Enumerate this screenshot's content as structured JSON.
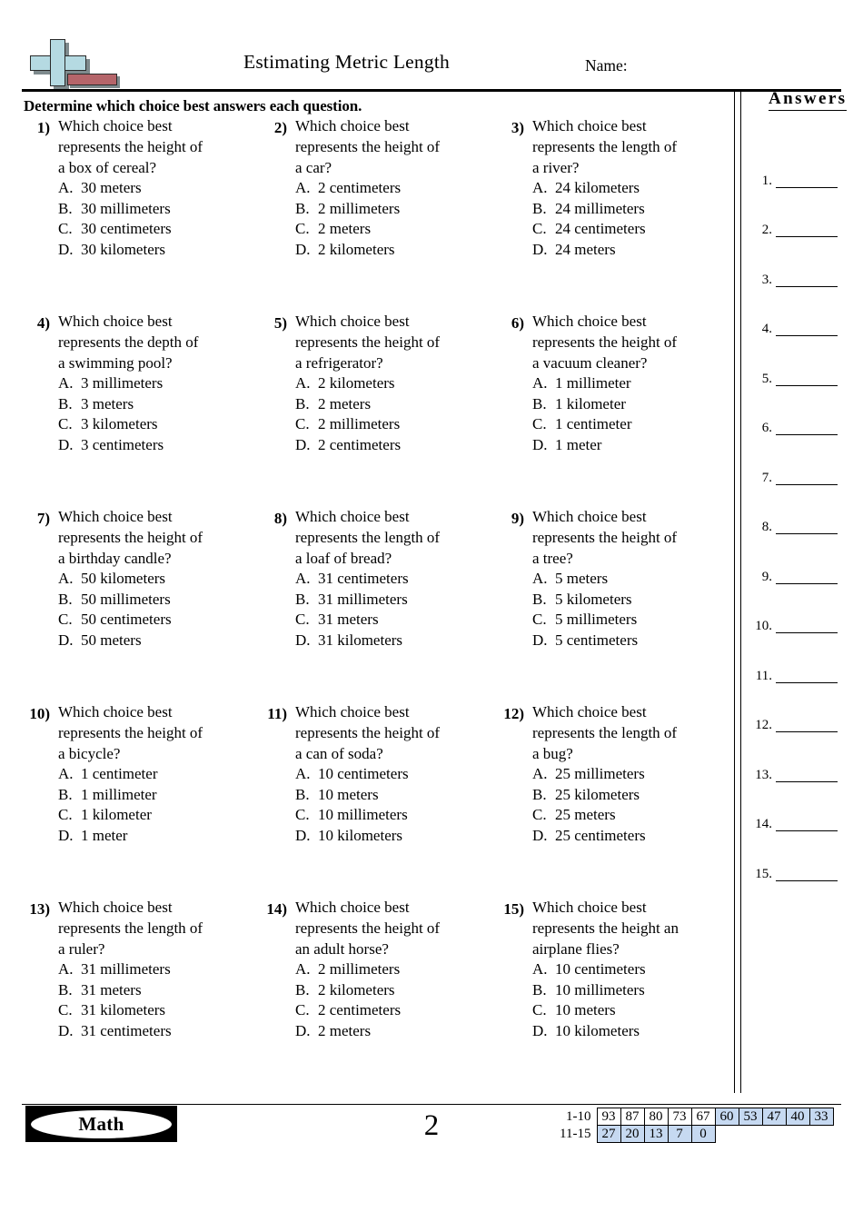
{
  "header": {
    "title": "Estimating Metric Length",
    "name_label": "Name:",
    "logo_name": "plus-minus-logo",
    "logo_colors": {
      "plus": "#b5dae2",
      "minus": "#b5656a",
      "shadow": "#7e8a8d"
    }
  },
  "instruction": "Determine which choice best answers each question.",
  "questions": [
    {
      "number": "1)",
      "text": "Which choice best\nrepresents the height of\na box of cereal?",
      "choices": [
        {
          "letter": "A.",
          "text": "30 meters"
        },
        {
          "letter": "B.",
          "text": "30 millimeters"
        },
        {
          "letter": "C.",
          "text": "30 centimeters"
        },
        {
          "letter": "D.",
          "text": "30 kilometers"
        }
      ]
    },
    {
      "number": "2)",
      "text": "Which choice best\nrepresents the height of\na car?",
      "choices": [
        {
          "letter": "A.",
          "text": "2 centimeters"
        },
        {
          "letter": "B.",
          "text": "2 millimeters"
        },
        {
          "letter": "C.",
          "text": "2 meters"
        },
        {
          "letter": "D.",
          "text": "2 kilometers"
        }
      ]
    },
    {
      "number": "3)",
      "text": "Which choice best\nrepresents the length of\na river?",
      "choices": [
        {
          "letter": "A.",
          "text": "24 kilometers"
        },
        {
          "letter": "B.",
          "text": "24 millimeters"
        },
        {
          "letter": "C.",
          "text": "24 centimeters"
        },
        {
          "letter": "D.",
          "text": "24 meters"
        }
      ]
    },
    {
      "number": "4)",
      "text": "Which choice best\nrepresents the depth of\na swimming pool?",
      "choices": [
        {
          "letter": "A.",
          "text": "3 millimeters"
        },
        {
          "letter": "B.",
          "text": "3 meters"
        },
        {
          "letter": "C.",
          "text": "3 kilometers"
        },
        {
          "letter": "D.",
          "text": "3 centimeters"
        }
      ]
    },
    {
      "number": "5)",
      "text": "Which choice best\nrepresents the height of\na refrigerator?",
      "choices": [
        {
          "letter": "A.",
          "text": "2 kilometers"
        },
        {
          "letter": "B.",
          "text": "2 meters"
        },
        {
          "letter": "C.",
          "text": "2 millimeters"
        },
        {
          "letter": "D.",
          "text": "2 centimeters"
        }
      ]
    },
    {
      "number": "6)",
      "text": "Which choice best\nrepresents the height of\na vacuum cleaner?",
      "choices": [
        {
          "letter": "A.",
          "text": "1 millimeter"
        },
        {
          "letter": "B.",
          "text": "1 kilometer"
        },
        {
          "letter": "C.",
          "text": "1 centimeter"
        },
        {
          "letter": "D.",
          "text": "1 meter"
        }
      ]
    },
    {
      "number": "7)",
      "text": "Which choice best\nrepresents the height of\na birthday candle?",
      "choices": [
        {
          "letter": "A.",
          "text": "50 kilometers"
        },
        {
          "letter": "B.",
          "text": "50 millimeters"
        },
        {
          "letter": "C.",
          "text": "50 centimeters"
        },
        {
          "letter": "D.",
          "text": "50 meters"
        }
      ]
    },
    {
      "number": "8)",
      "text": "Which choice best\nrepresents the length of\na loaf of bread?",
      "choices": [
        {
          "letter": "A.",
          "text": "31 centimeters"
        },
        {
          "letter": "B.",
          "text": "31 millimeters"
        },
        {
          "letter": "C.",
          "text": "31 meters"
        },
        {
          "letter": "D.",
          "text": "31 kilometers"
        }
      ]
    },
    {
      "number": "9)",
      "text": "Which choice best\nrepresents the height of\na tree?",
      "choices": [
        {
          "letter": "A.",
          "text": "5 meters"
        },
        {
          "letter": "B.",
          "text": "5 kilometers"
        },
        {
          "letter": "C.",
          "text": "5 millimeters"
        },
        {
          "letter": "D.",
          "text": "5 centimeters"
        }
      ]
    },
    {
      "number": "10)",
      "text": "Which choice best\nrepresents the height of\na bicycle?",
      "choices": [
        {
          "letter": "A.",
          "text": "1 centimeter"
        },
        {
          "letter": "B.",
          "text": "1 millimeter"
        },
        {
          "letter": "C.",
          "text": "1 kilometer"
        },
        {
          "letter": "D.",
          "text": "1 meter"
        }
      ]
    },
    {
      "number": "11)",
      "text": "Which choice best\nrepresents the height of\na can of soda?",
      "choices": [
        {
          "letter": "A.",
          "text": "10 centimeters"
        },
        {
          "letter": "B.",
          "text": "10 meters"
        },
        {
          "letter": "C.",
          "text": "10 millimeters"
        },
        {
          "letter": "D.",
          "text": "10 kilometers"
        }
      ]
    },
    {
      "number": "12)",
      "text": "Which choice best\nrepresents the length of\na bug?",
      "choices": [
        {
          "letter": "A.",
          "text": "25 millimeters"
        },
        {
          "letter": "B.",
          "text": "25 kilometers"
        },
        {
          "letter": "C.",
          "text": "25 meters"
        },
        {
          "letter": "D.",
          "text": "25 centimeters"
        }
      ]
    },
    {
      "number": "13)",
      "text": "Which choice best\nrepresents the length of\na ruler?",
      "choices": [
        {
          "letter": "A.",
          "text": "31 millimeters"
        },
        {
          "letter": "B.",
          "text": "31 meters"
        },
        {
          "letter": "C.",
          "text": "31 kilometers"
        },
        {
          "letter": "D.",
          "text": "31 centimeters"
        }
      ]
    },
    {
      "number": "14)",
      "text": "Which choice best\nrepresents the height of\nan adult horse?",
      "choices": [
        {
          "letter": "A.",
          "text": "2 millimeters"
        },
        {
          "letter": "B.",
          "text": "2 kilometers"
        },
        {
          "letter": "C.",
          "text": "2 centimeters"
        },
        {
          "letter": "D.",
          "text": "2 meters"
        }
      ]
    },
    {
      "number": "15)",
      "text": "Which choice best\nrepresents the height an\nairplane flies?",
      "choices": [
        {
          "letter": "A.",
          "text": "10 centimeters"
        },
        {
          "letter": "B.",
          "text": "10 millimeters"
        },
        {
          "letter": "C.",
          "text": "10 meters"
        },
        {
          "letter": "D.",
          "text": "10 kilometers"
        }
      ]
    }
  ],
  "answers": {
    "title": "Answers",
    "items": [
      "1.",
      "2.",
      "3.",
      "4.",
      "5.",
      "6.",
      "7.",
      "8.",
      "9.",
      "10.",
      "11.",
      "12.",
      "13.",
      "14.",
      "15."
    ]
  },
  "footer": {
    "subject_badge": "Math",
    "page_number": "2",
    "score_table": {
      "rows": [
        {
          "label": "1-10",
          "cells": [
            {
              "value": "93",
              "highlight": false
            },
            {
              "value": "87",
              "highlight": false
            },
            {
              "value": "80",
              "highlight": false
            },
            {
              "value": "73",
              "highlight": false
            },
            {
              "value": "67",
              "highlight": false
            },
            {
              "value": "60",
              "highlight": true
            },
            {
              "value": "53",
              "highlight": true
            },
            {
              "value": "47",
              "highlight": true
            },
            {
              "value": "40",
              "highlight": true
            },
            {
              "value": "33",
              "highlight": true
            }
          ]
        },
        {
          "label": "11-15",
          "cells": [
            {
              "value": "27",
              "highlight": true
            },
            {
              "value": "20",
              "highlight": true
            },
            {
              "value": "13",
              "highlight": true
            },
            {
              "value": "7",
              "highlight": true
            },
            {
              "value": "0",
              "highlight": true
            }
          ]
        }
      ],
      "highlight_color": "#c6d9f1"
    }
  }
}
